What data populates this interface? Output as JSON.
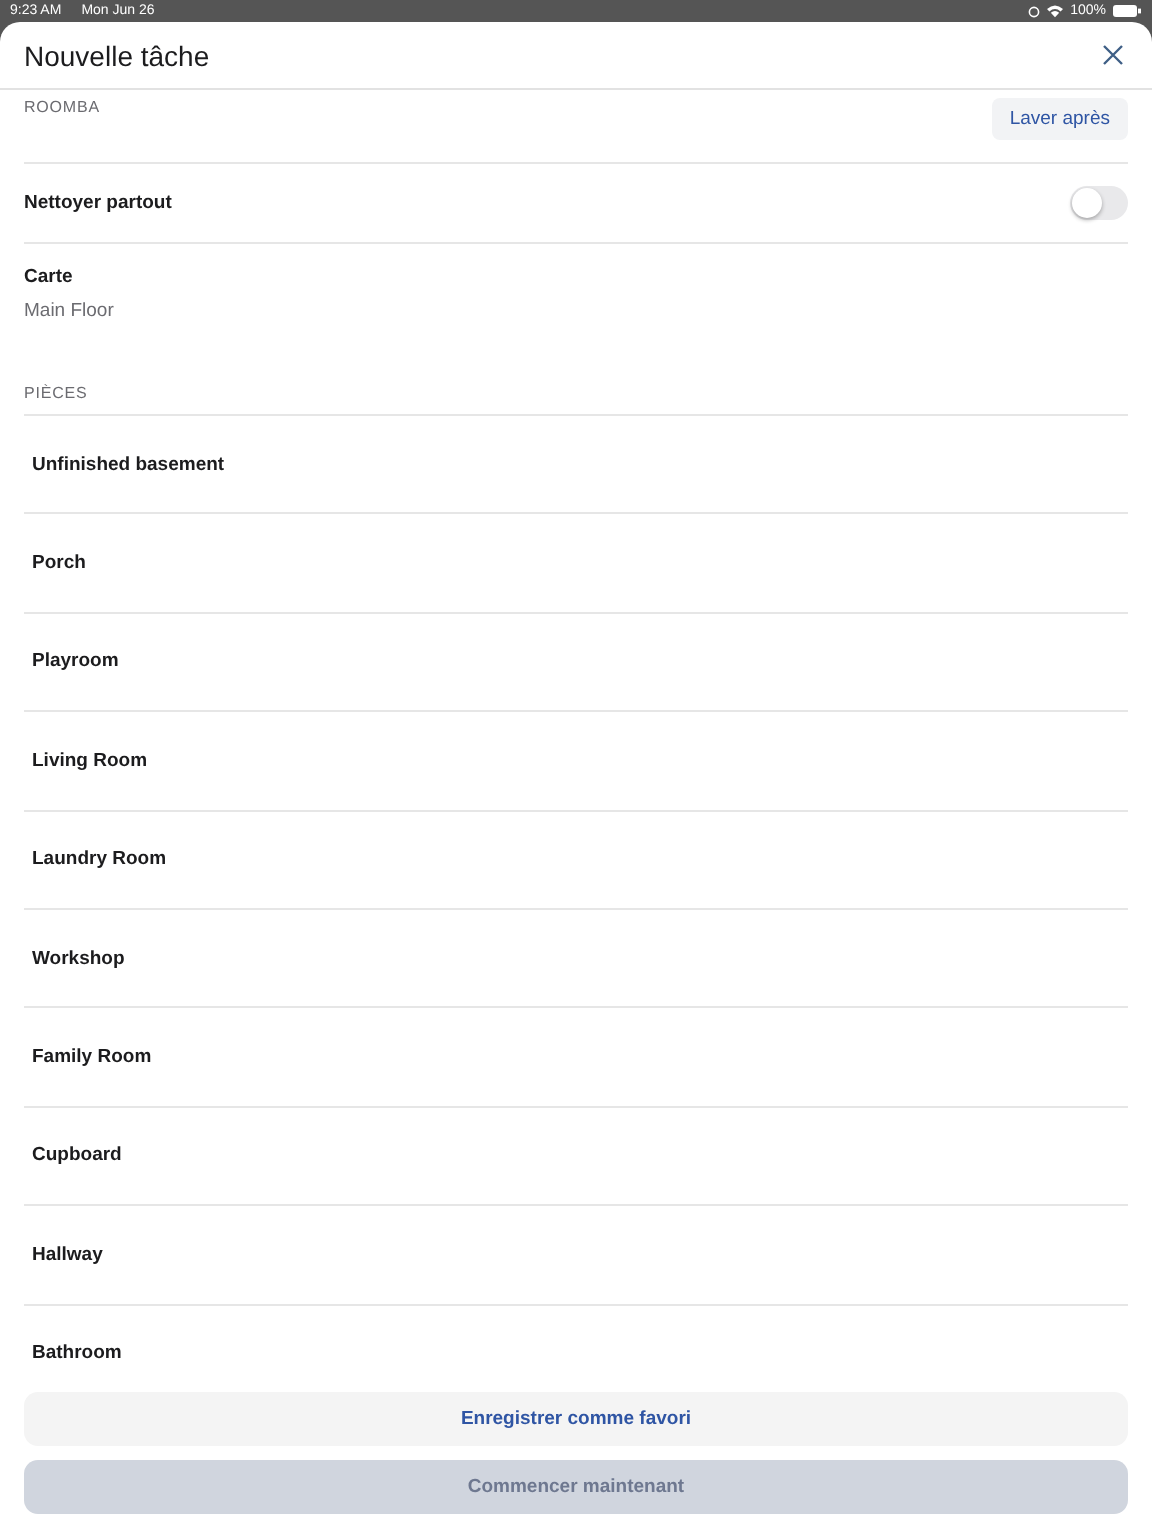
{
  "status_bar": {
    "time": "9:23 AM",
    "date": "Mon Jun 26",
    "battery": "100%"
  },
  "sheet": {
    "title": "Nouvelle tâche"
  },
  "robot": {
    "label": "ROOMBA",
    "action": "Laver après"
  },
  "clean_everywhere": {
    "label": "Nettoyer partout",
    "on": false
  },
  "map": {
    "label": "Carte",
    "value": "Main Floor"
  },
  "rooms": {
    "label": "PIÈCES",
    "items": [
      {
        "name": "Unfinished basement"
      },
      {
        "name": "Porch"
      },
      {
        "name": "Playroom"
      },
      {
        "name": "Living Room"
      },
      {
        "name": "Laundry Room"
      },
      {
        "name": "Workshop"
      },
      {
        "name": "Family Room"
      },
      {
        "name": "Cupboard"
      },
      {
        "name": "Hallway"
      },
      {
        "name": "Bathroom"
      }
    ]
  },
  "buttons": [
    {
      "label": "Enregistrer comme favori",
      "disabled": false
    },
    {
      "label": "Commencer maintenant",
      "disabled": true
    }
  ]
}
